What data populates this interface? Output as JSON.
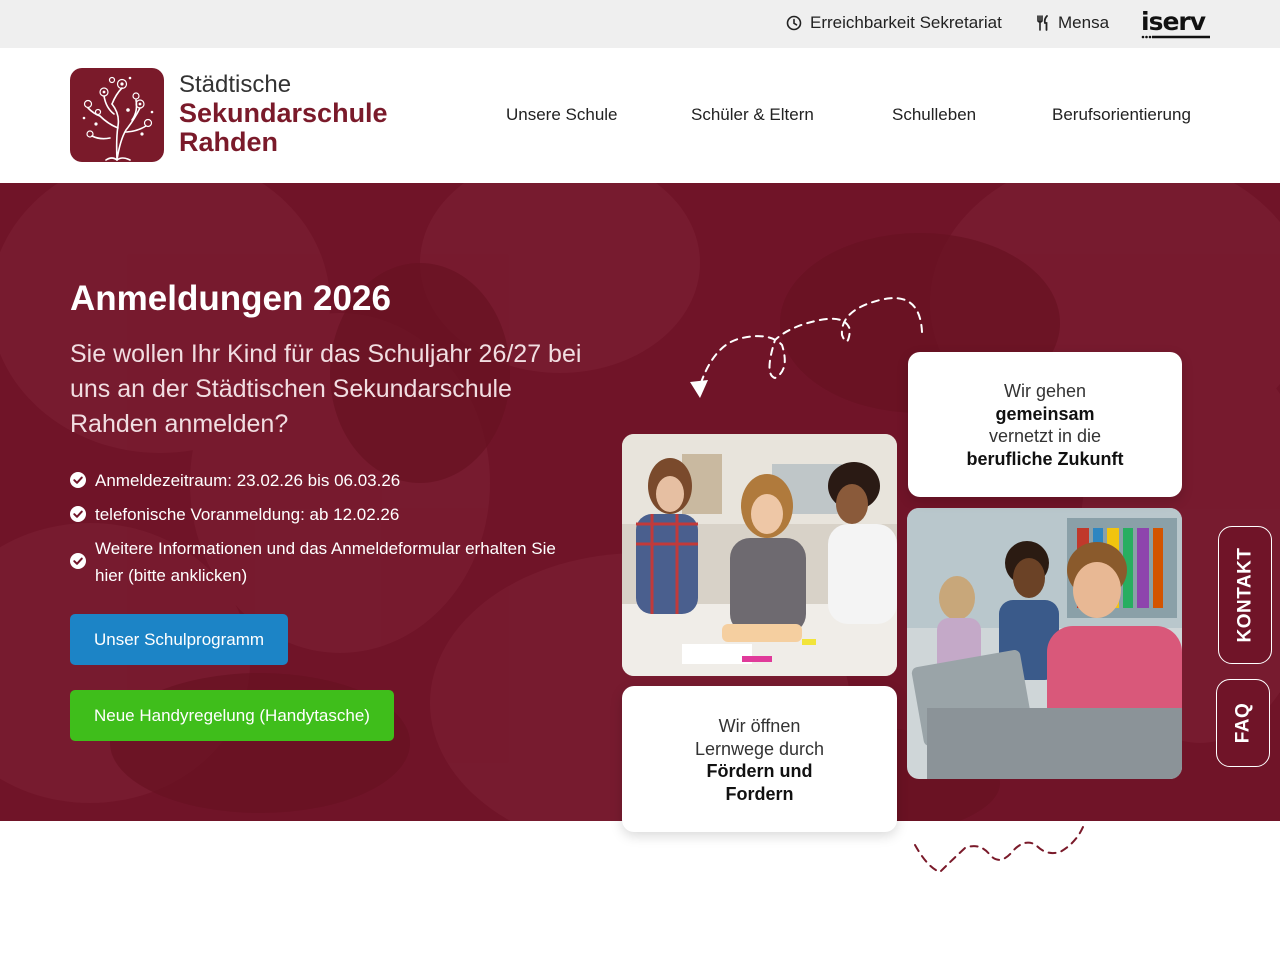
{
  "topbar": {
    "sekretariat_label": "Erreichbarkeit Sekretariat",
    "mensa_label": "Mensa",
    "iserv_logo_text": "iserv"
  },
  "logo": {
    "line1": "Städtische",
    "line2": "Sekundarschule",
    "line3": "Rahden"
  },
  "nav": {
    "items": [
      {
        "label": "Unsere Schule"
      },
      {
        "label": "Schüler & Eltern"
      },
      {
        "label": "Schulleben"
      },
      {
        "label": "Berufsorientierung"
      }
    ]
  },
  "hero": {
    "title": "Anmeldungen 2026",
    "lead": "Sie wollen Ihr Kind für das Schuljahr 26/27 bei uns an der Städtischen Sekundarschule Rahden anmelden?",
    "checklist": [
      "Anmeldezeitraum: 23.02.26 bis 06.03.26",
      "telefonische Voranmeldung: ab 12.02.26",
      "Weitere Informationen und das Anmeldeformular erhalten Sie hier (bitte anklicken)"
    ],
    "button_schulprogramm": "Unser Schulprogramm",
    "button_handy": "Neue Handyregelung (Handytasche)"
  },
  "cards": {
    "card1": {
      "l1": "Wir gehen",
      "l2": "gemeinsam",
      "l3": "vernetzt in die",
      "l4": "berufliche Zukunft"
    },
    "card2": {
      "l1": "Wir öffnen",
      "l2": "Lernwege durch",
      "l3": "Fördern und",
      "l4": "Fordern"
    }
  },
  "side_tabs": {
    "kontakt": "KONTAKT",
    "faq": "FAQ"
  },
  "colors": {
    "brand": "#7a1a2a",
    "hero_bg": "#701428",
    "button_blue": "#1c84c6",
    "button_green": "#3fbe1b",
    "topbar_bg": "#efefef"
  },
  "icons": {
    "sekretariat": "clock-icon",
    "mensa": "cutlery-icon",
    "check": "check-circle-icon"
  }
}
